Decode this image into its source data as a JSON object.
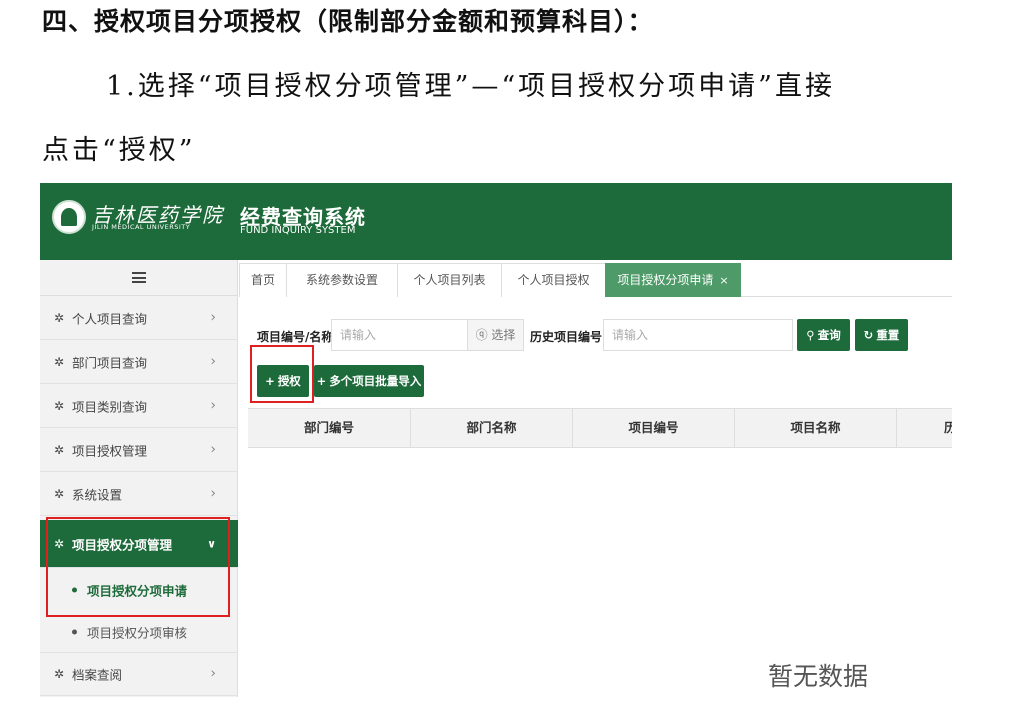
{
  "document": {
    "heading": "四、授权项目分项授权（限制部分金额和预算科目）：",
    "step_line1": "1.选择“项目授权分项管理”—“项目授权分项申请”直接",
    "step_line2": "点击“授权”"
  },
  "app": {
    "logo_cn": "吉林医药学院",
    "logo_en": "JILIN MEDICAL UNIVERSITY",
    "title": "经费查询系统",
    "subtitle": "FUND INQUIRY SYSTEM",
    "brand_color": "#1d6b3a",
    "sidebar": {
      "items": [
        {
          "label": "个人项目查询",
          "icon": "gear-icon"
        },
        {
          "label": "部门项目查询",
          "icon": "gear-icon"
        },
        {
          "label": "项目类别查询",
          "icon": "gear-icon"
        },
        {
          "label": "项目授权管理",
          "icon": "gear-icon"
        },
        {
          "label": "系统设置",
          "icon": "gear-icon"
        },
        {
          "label": "项目授权分项管理",
          "icon": "gear-icon",
          "expanded": true
        },
        {
          "label": "档案查阅",
          "icon": "gear-icon"
        }
      ],
      "subitems": [
        {
          "label": "项目授权分项申请",
          "current": true
        },
        {
          "label": "项目授权分项审核"
        }
      ]
    },
    "tabs": [
      {
        "label": "首页"
      },
      {
        "label": "系统参数设置"
      },
      {
        "label": "个人项目列表"
      },
      {
        "label": "个人项目授权"
      },
      {
        "label": "项目授权分项申请",
        "active": true,
        "close": "×"
      }
    ],
    "search": {
      "project_label": "项目编号/名称",
      "project_placeholder": "请输入",
      "select_label": "选择",
      "history_label": "历史项目编号",
      "history_placeholder": "请输入",
      "query_label": "查询",
      "reset_label": "重置"
    },
    "actions": {
      "authorize_label": "授权",
      "batch_import_label": "多个项目批量导入"
    },
    "table": {
      "columns": [
        "部门编号",
        "部门名称",
        "项目编号",
        "项目名称",
        "历"
      ],
      "empty_text": "暂无数据"
    }
  }
}
